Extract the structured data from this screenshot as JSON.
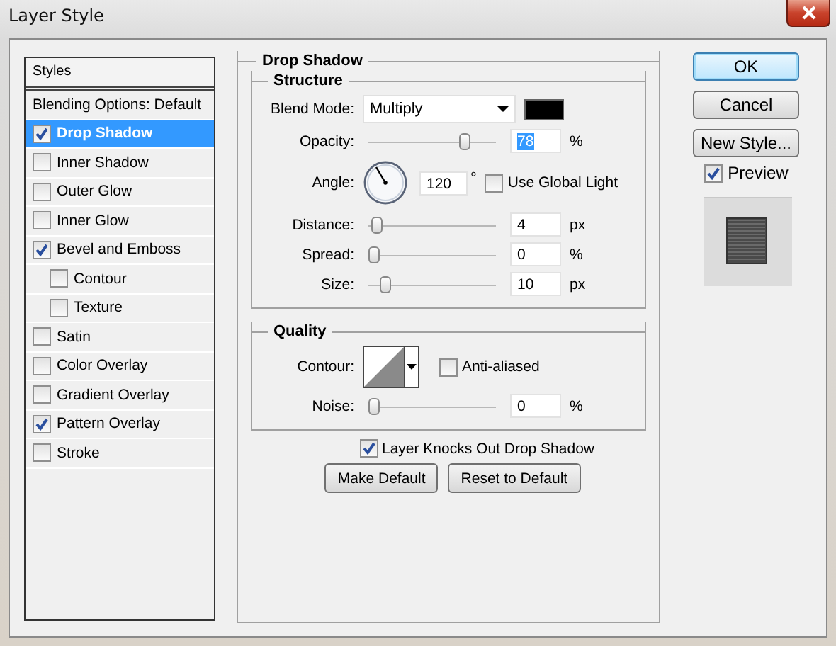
{
  "window": {
    "title": "Layer Style"
  },
  "sidebar": {
    "header": "Styles",
    "items": [
      {
        "label": "Blending Options: Default",
        "kind": "option",
        "selected": false
      },
      {
        "label": "Drop Shadow",
        "kind": "effect",
        "checked": true,
        "selected": true
      },
      {
        "label": "Inner Shadow",
        "kind": "effect",
        "checked": false,
        "selected": false
      },
      {
        "label": "Outer Glow",
        "kind": "effect",
        "checked": false,
        "selected": false
      },
      {
        "label": "Inner Glow",
        "kind": "effect",
        "checked": false,
        "selected": false
      },
      {
        "label": "Bevel and Emboss",
        "kind": "effect",
        "checked": true,
        "selected": false,
        "children": [
          {
            "label": "Contour",
            "kind": "effect",
            "checked": false,
            "selected": false
          },
          {
            "label": "Texture",
            "kind": "effect",
            "checked": false,
            "selected": false
          }
        ]
      },
      {
        "label": "Satin",
        "kind": "effect",
        "checked": false,
        "selected": false
      },
      {
        "label": "Color Overlay",
        "kind": "effect",
        "checked": false,
        "selected": false
      },
      {
        "label": "Gradient Overlay",
        "kind": "effect",
        "checked": false,
        "selected": false
      },
      {
        "label": "Pattern Overlay",
        "kind": "effect",
        "checked": true,
        "selected": false
      },
      {
        "label": "Stroke",
        "kind": "effect",
        "checked": false,
        "selected": false
      }
    ]
  },
  "panel": {
    "title": "Drop Shadow",
    "structure": {
      "title": "Structure",
      "rows": [
        {
          "kind": "select",
          "label": "Blend Mode:",
          "value": "Multiply",
          "color": "#000000"
        },
        {
          "kind": "slider",
          "label": "Opacity:",
          "level": 0.78,
          "value": "78",
          "value_selected": true,
          "unit": "%"
        },
        {
          "kind": "angle",
          "label": "Angle:",
          "value": "120",
          "unit": "°",
          "checkbox": {
            "label": "Use Global Light",
            "checked": false
          }
        },
        {
          "kind": "slider",
          "label": "Distance:",
          "level": 0.03,
          "value": "4",
          "value_selected": false,
          "unit": "px"
        },
        {
          "kind": "slider",
          "label": "Spread:",
          "level": 0.0,
          "value": "0",
          "value_selected": false,
          "unit": "%"
        },
        {
          "kind": "slider",
          "label": "Size:",
          "level": 0.1,
          "value": "10",
          "value_selected": false,
          "unit": "px"
        }
      ]
    },
    "quality": {
      "title": "Quality",
      "rows": [
        {
          "kind": "contour",
          "label": "Contour:",
          "checkbox": {
            "label": "Anti-aliased",
            "checked": false
          }
        },
        {
          "kind": "slider",
          "label": "Noise:",
          "level": 0.0,
          "value": "0",
          "value_selected": false,
          "unit": "%"
        }
      ]
    },
    "knockout": {
      "label": "Layer Knocks Out Drop Shadow",
      "checked": true
    },
    "buttons": [
      "Make Default",
      "Reset to Default"
    ]
  },
  "actions": {
    "buttons": [
      {
        "label": "OK",
        "default": true
      },
      {
        "label": "Cancel",
        "default": false
      },
      {
        "label": "New Style...",
        "default": false
      }
    ],
    "preview": {
      "label": "Preview",
      "checked": true
    }
  }
}
